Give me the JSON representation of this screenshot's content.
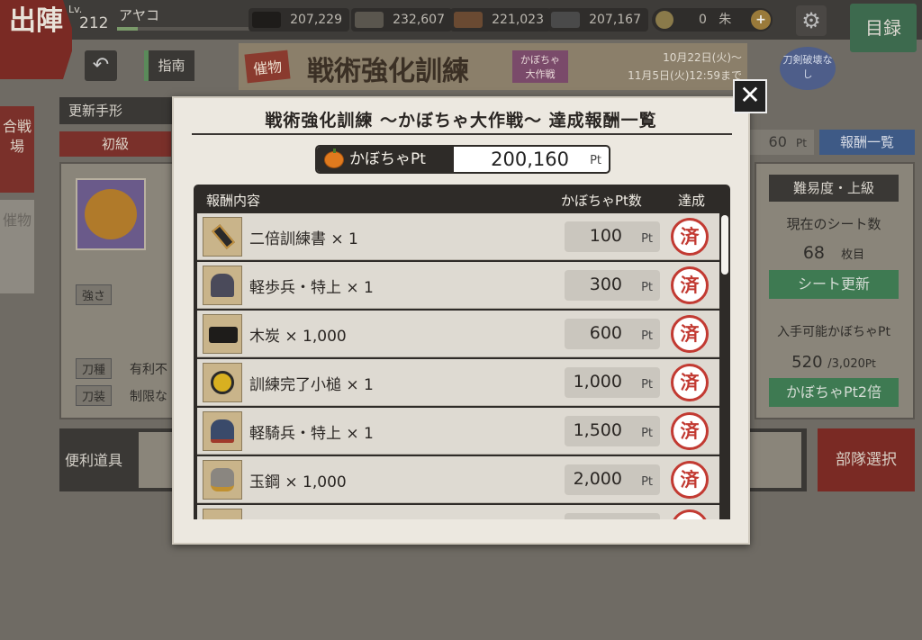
{
  "header": {
    "sortie_label": "出陣",
    "level_label": "Lv.",
    "level": "212",
    "player_name": "アヤコ",
    "resources": [
      {
        "icon": "charcoal-icon",
        "value": "207,229"
      },
      {
        "icon": "tamahagane-icon",
        "value": "232,607"
      },
      {
        "icon": "cooling-material-icon",
        "value": "221,023"
      },
      {
        "icon": "whetstone-icon",
        "value": "207,167"
      }
    ],
    "coin_value": "0",
    "coin_suffix": "朱",
    "catalog_label": "目録"
  },
  "nav": {
    "guide_label": "指南"
  },
  "event_banner": {
    "tag": "催物",
    "title": "戦術強化訓練",
    "subtitle": "かぼちゃ大作戦",
    "date_start": "10月22日(火)〜",
    "date_end": "11月5日(火)12:59まで",
    "no_break_label": "刀剣破壊なし"
  },
  "background": {
    "left_tabs": [
      "合戦場",
      "催物"
    ],
    "renew_label": "更新手形",
    "grade_label": "初級",
    "strength_label": "強さ",
    "sword_type_label": "刀種",
    "sword_type_value": "有利不",
    "equip_label": "刀装",
    "equip_value": "制限な",
    "pt_value_partial": "60",
    "pt_unit": "Pt",
    "reward_list_label": "報酬一覧",
    "difficulty_label": "難易度・上級",
    "sheet_count_label": "現在のシート数",
    "sheet_count": "68",
    "sheet_unit": "枚目",
    "sheet_renew_label": "シート更新",
    "available_pt_label": "入手可能かぼちゃPt",
    "available_pt": "520",
    "available_pt_total": "/3,020",
    "double_pt_label": "かぼちゃPt2倍",
    "tools_label": "便利道具",
    "squad_select_label": "部隊選択"
  },
  "dialog": {
    "title": "戦術強化訓練 〜かぼちゃ大作戦〜 達成報酬一覧",
    "pt_label": "かぼちゃPt",
    "pt_value": "200,160",
    "pt_unit": "Pt",
    "headers": {
      "content": "報酬内容",
      "points": "かぼちゃPt数",
      "achieved": "達成"
    },
    "rows": [
      {
        "name": "二倍訓練書 × 1",
        "pt": "100",
        "unit": "Pt",
        "status": "済",
        "icon": "scroll-icon"
      },
      {
        "name": "軽歩兵・特上 × 1",
        "pt": "300",
        "unit": "Pt",
        "status": "済",
        "icon": "light-infantry-icon"
      },
      {
        "name": "木炭 × 1,000",
        "pt": "600",
        "unit": "Pt",
        "status": "済",
        "icon": "charcoal-icon"
      },
      {
        "name": "訓練完了小槌 × 1",
        "pt": "1,000",
        "unit": "Pt",
        "status": "済",
        "icon": "mallet-icon"
      },
      {
        "name": "軽騎兵・特上 × 1",
        "pt": "1,500",
        "unit": "Pt",
        "status": "済",
        "icon": "light-cavalry-icon"
      },
      {
        "name": "玉鋼 × 1,000",
        "pt": "2,000",
        "unit": "Pt",
        "status": "済",
        "icon": "tamahagane-icon"
      }
    ],
    "close_glyph": "✕"
  }
}
